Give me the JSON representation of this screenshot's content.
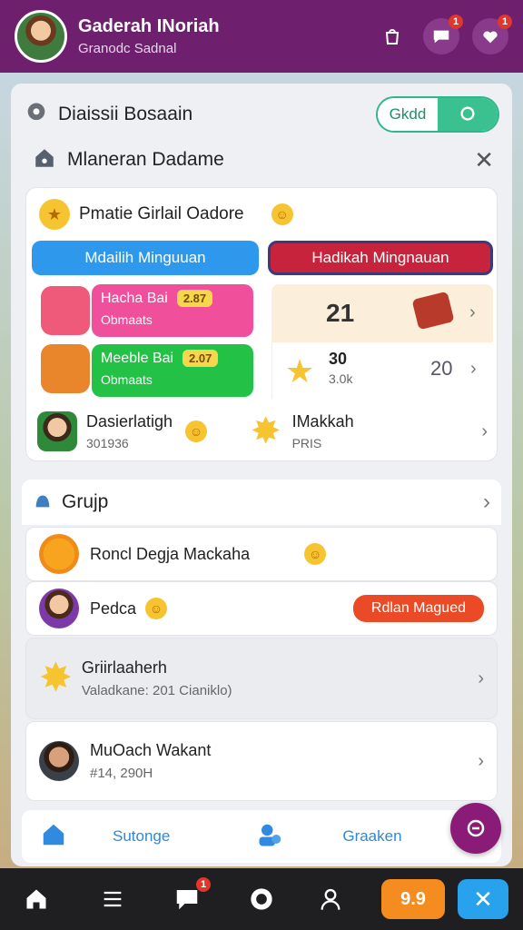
{
  "header": {
    "title": "Gaderah INoriah",
    "subtitle": "Granodc Sadnal",
    "icons": [
      "bag-icon",
      "chat-icon",
      "heart-chat-icon"
    ],
    "badges": {
      "chat": "1",
      "heart": "1"
    }
  },
  "top_row": {
    "label": "Diaissii Bosaain",
    "toggle_label": "Gkdd"
  },
  "section": {
    "label": "Mlaneran Dadame"
  },
  "card": {
    "title": "Pmatie Girlail Oadore",
    "tabs": [
      "Mdailih Minguuan",
      "Hadikah Mingnauan"
    ],
    "row1": {
      "title": "Hacha Bai",
      "tag": "2.87",
      "sub": "Obmaats"
    },
    "row2": {
      "title": "Meeble Bai",
      "tag": "2.07",
      "sub": "Obmaats"
    },
    "right1": {
      "value": "21"
    },
    "right2": {
      "value": "30",
      "sub": "3.0k",
      "value_b": "20"
    },
    "bottom_left": {
      "name": "Dasierlatigh",
      "sub": "301936"
    },
    "bottom_right": {
      "name": "IMakkah",
      "sub": "PRIS"
    }
  },
  "group": {
    "label": "Grujp"
  },
  "list": [
    {
      "name": "Roncl Degja Mackaha",
      "sub": ""
    },
    {
      "name": "Pedca",
      "sub": "",
      "button": "Rdlan Magued"
    },
    {
      "name": "Griirlaaherh",
      "sub": "Valadkane: 201 Cianiklo)"
    },
    {
      "name": "MuOach Wakant",
      "sub": "#14, 290H"
    }
  ],
  "subnav": {
    "left": "Sutonge",
    "right": "Graaken"
  },
  "bottombar": {
    "badge_chat": "1",
    "orange": "9.9",
    "blue": "✕"
  },
  "colors": {
    "header": "#6e1f6e",
    "accent_green": "#3bc090",
    "tab_blue": "#2e98ec",
    "tab_red": "#c8233c",
    "pink": "#f04f9b",
    "green": "#23c247",
    "orange": "#f58c1f"
  }
}
